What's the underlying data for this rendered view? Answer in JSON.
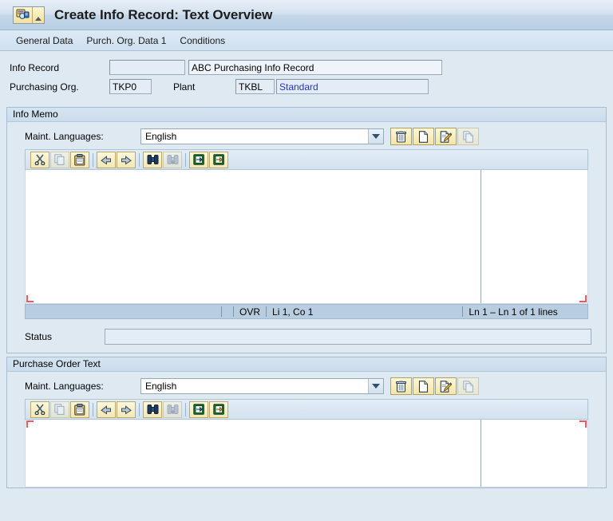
{
  "window": {
    "title": "Create Info Record: Text Overview",
    "system_menu_icon": "sap-info-record-icon",
    "system_menu_arrow_icon": "chevron-down-icon"
  },
  "nav": {
    "items": [
      {
        "label": "General Data"
      },
      {
        "label": "Purch. Org. Data 1"
      },
      {
        "label": "Conditions"
      }
    ]
  },
  "header_fields": {
    "info_record": {
      "label": "Info Record",
      "number_value": "",
      "number_placeholder": "",
      "description_value": "ABC Purchasing Info Record"
    },
    "purchasing_org": {
      "label": "Purchasing Org.",
      "value": "TKP0"
    },
    "plant": {
      "label": "Plant",
      "value": "TKBL",
      "description": "Standard"
    }
  },
  "info_memo": {
    "title": "Info Memo",
    "maint_languages_label": "Maint. Languages:",
    "language_value": "English",
    "language_options": [
      "English"
    ],
    "dropdown_icon": "chevron-down-icon",
    "action_buttons": [
      {
        "name": "delete-text-button",
        "icon": "trash-icon",
        "enabled": true
      },
      {
        "name": "create-text-button",
        "icon": "new-document-icon",
        "enabled": true
      },
      {
        "name": "edit-text-button",
        "icon": "edit-document-pencil-icon",
        "enabled": true
      },
      {
        "name": "copy-text-button",
        "icon": "copy-documents-icon",
        "enabled": false
      }
    ],
    "editor_toolbar": [
      {
        "name": "cut-button",
        "icon": "scissors-icon",
        "enabled": true
      },
      {
        "name": "copy-button",
        "icon": "copy-icon",
        "enabled": false
      },
      {
        "name": "paste-button",
        "icon": "clipboard-paste-icon",
        "enabled": true
      },
      {
        "name": "undo-button",
        "icon": "undo-arrow-icon",
        "enabled": true
      },
      {
        "name": "redo-button",
        "icon": "redo-arrow-icon",
        "enabled": true
      },
      {
        "name": "find-button",
        "icon": "binoculars-find-icon",
        "enabled": true
      },
      {
        "name": "find-next-button",
        "icon": "binoculars-find-next-icon",
        "enabled": false
      },
      {
        "name": "import-text-button",
        "icon": "import-arrow-icon",
        "enabled": true
      },
      {
        "name": "export-text-button",
        "icon": "export-arrow-icon",
        "enabled": true
      }
    ],
    "text_value": "",
    "editor_status": {
      "overwrite_mode": "OVR",
      "cursor_position": "Li 1, Co 1",
      "line_info": "Ln 1 – Ln 1 of 1 lines"
    },
    "status_field": {
      "label": "Status",
      "value": ""
    }
  },
  "purchase_order_text": {
    "title": "Purchase Order Text",
    "maint_languages_label": "Maint. Languages:",
    "language_value": "English",
    "language_options": [
      "English"
    ],
    "dropdown_icon": "chevron-down-icon",
    "action_buttons": [
      {
        "name": "delete-text-button",
        "icon": "trash-icon",
        "enabled": true
      },
      {
        "name": "create-text-button",
        "icon": "new-document-icon",
        "enabled": true
      },
      {
        "name": "edit-text-button",
        "icon": "edit-document-pencil-icon",
        "enabled": true
      },
      {
        "name": "copy-text-button",
        "icon": "copy-documents-icon",
        "enabled": false
      }
    ],
    "editor_toolbar": [
      {
        "name": "cut-button",
        "icon": "scissors-icon",
        "enabled": true
      },
      {
        "name": "copy-button",
        "icon": "copy-icon",
        "enabled": false
      },
      {
        "name": "paste-button",
        "icon": "clipboard-paste-icon",
        "enabled": true
      },
      {
        "name": "undo-button",
        "icon": "undo-arrow-icon",
        "enabled": true
      },
      {
        "name": "redo-button",
        "icon": "redo-arrow-icon",
        "enabled": true
      },
      {
        "name": "find-button",
        "icon": "binoculars-find-icon",
        "enabled": true
      },
      {
        "name": "find-next-button",
        "icon": "binoculars-find-next-icon",
        "enabled": false
      },
      {
        "name": "import-text-button",
        "icon": "import-arrow-icon",
        "enabled": true
      },
      {
        "name": "export-text-button",
        "icon": "export-arrow-icon",
        "enabled": true
      }
    ],
    "text_value": ""
  },
  "colors": {
    "window_background": "#dfe9f2",
    "title_bar": "#c4d6e8",
    "group_border": "#a8bdd2",
    "field_background": "#e4edf5",
    "field_border": "#9aabbb",
    "link_text": "#2433d8",
    "editor_status_bar": "#b9cde0",
    "corner_marker": "#f4575f",
    "button_gold": "#f3e6a8"
  }
}
